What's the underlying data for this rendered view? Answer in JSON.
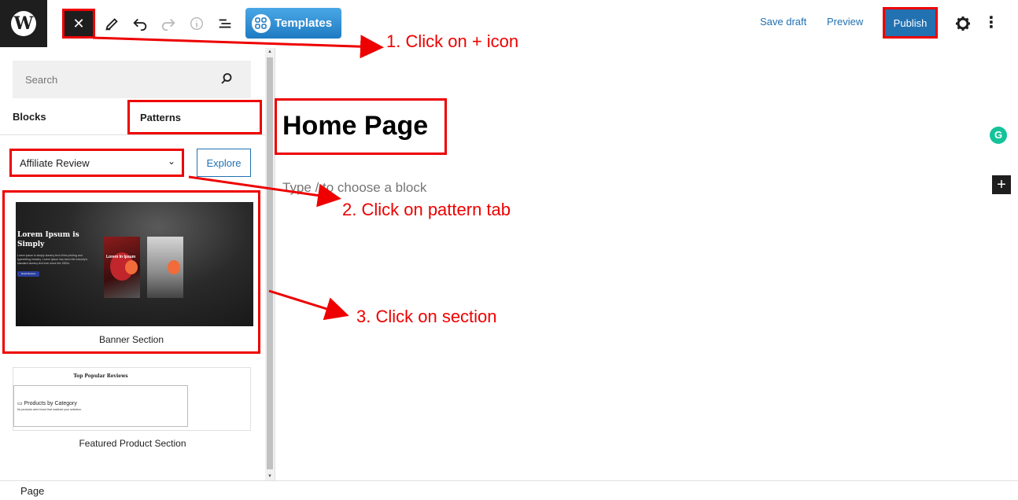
{
  "toolbar": {
    "close_icon": "close-icon",
    "templates_label": "Templates",
    "save_draft_label": "Save draft",
    "preview_label": "Preview",
    "publish_label": "Publish"
  },
  "sidebar": {
    "search_placeholder": "Search",
    "tabs": [
      {
        "label": "Blocks"
      },
      {
        "label": "Patterns"
      }
    ],
    "category_select": "Affiliate Review",
    "explore_label": "Explore",
    "patterns": [
      {
        "label": "Banner Section",
        "preview": {
          "headline": "Lorem Ipsum is Simply",
          "body": "Lorem ipsum is simply dummy text of the printing and typesetting industry. Lorem Ipsum has been the industry's standard dummy text ever since the 1500s.",
          "button": "Read Review",
          "card_label": "Lorem In Ipsum"
        }
      },
      {
        "label": "Featured Product Section",
        "preview": {
          "title": "Top Popular Reviews",
          "category": "Products by Category",
          "note": "No products were found that matched your selection."
        }
      }
    ]
  },
  "editor": {
    "page_title": "Home Page",
    "block_placeholder": "Type / to choose a block"
  },
  "annotations": [
    "1. Click on + icon",
    "2. Click on pattern tab",
    "3. Click on section"
  ],
  "footer": {
    "breadcrumb": "Page"
  },
  "colors": {
    "accent": "#2271b1",
    "annotation": "#e00000",
    "dark": "#1e1e1e"
  }
}
